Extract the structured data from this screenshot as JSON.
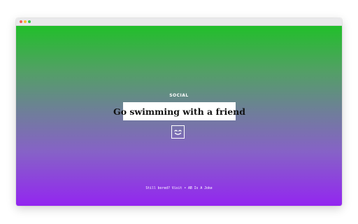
{
  "window": {
    "controls": [
      "close",
      "minimize",
      "zoom"
    ]
  },
  "activity": {
    "category": "SOCIAL",
    "text": "Go swimming with a friend"
  },
  "refresh_button": {
    "icon": "smiley-face-icon"
  },
  "footer": {
    "prefix": "Still bored? Visit",
    "separator": "•",
    "link_text": "AB Is A Joke"
  },
  "colors": {
    "gradient_top": "#21bf2a",
    "gradient_bottom": "#9326f0",
    "card_background": "#ffffff",
    "text_dark": "#111111"
  }
}
